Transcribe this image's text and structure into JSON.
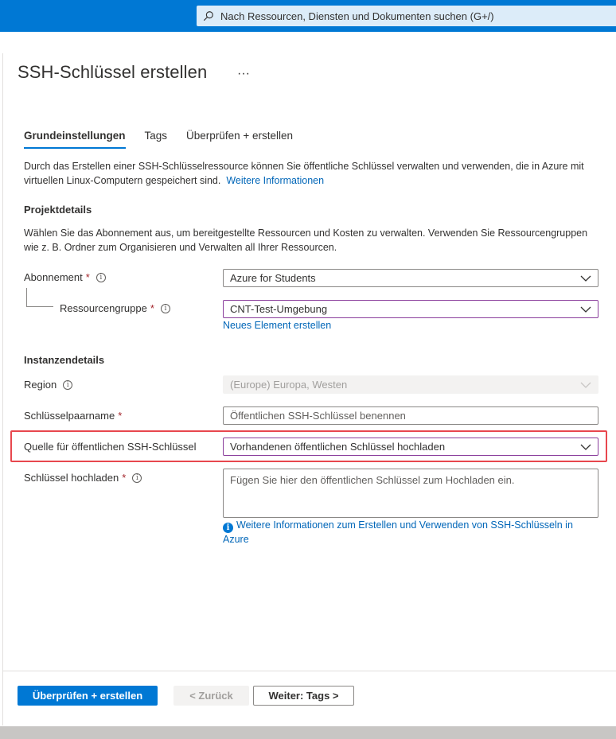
{
  "search": {
    "placeholder": "Nach Ressourcen, Diensten und Dokumenten suchen (G+/)"
  },
  "header": {
    "title": "SSH-Schlüssel erstellen",
    "more": "···"
  },
  "tabs": [
    {
      "label": "Grundeinstellungen",
      "active": true
    },
    {
      "label": "Tags",
      "active": false
    },
    {
      "label": "Überprüfen + erstellen",
      "active": false
    }
  ],
  "intro": {
    "text": "Durch das Erstellen einer SSH-Schlüsselressource können Sie öffentliche Schlüssel verwalten und verwenden, die in Azure mit virtuellen Linux-Computern gespeichert sind.",
    "link": "Weitere Informationen"
  },
  "project": {
    "heading": "Projektdetails",
    "description": "Wählen Sie das Abonnement aus, um bereitgestellte Ressourcen und Kosten zu verwalten. Verwenden Sie Ressourcengruppen wie z. B. Ordner zum Organisieren und Verwalten all Ihrer Ressourcen.",
    "subscription_label": "Abonnement",
    "subscription_value": "Azure for Students",
    "resource_group_label": "Ressourcengruppe",
    "resource_group_value": "CNT-Test-Umgebung",
    "new_element_link": "Neues Element erstellen"
  },
  "instance": {
    "heading": "Instanzendetails",
    "region_label": "Region",
    "region_value": "(Europe) Europa, Westen",
    "keypair_label": "Schlüsselpaarname",
    "keypair_placeholder": "Öffentlichen SSH-Schlüssel benennen",
    "source_label": "Quelle für öffentlichen SSH-Schlüssel",
    "source_value": "Vorhandenen öffentlichen Schlüssel hochladen",
    "upload_label": "Schlüssel hochladen",
    "upload_placeholder": "Fügen Sie hier den öffentlichen Schlüssel zum Hochladen ein.",
    "info_link": "Weitere Informationen zum Erstellen und Verwenden von SSH-Schlüsseln in Azure"
  },
  "footer": {
    "review_button": "Überprüfen + erstellen",
    "back_button": "< Zurück",
    "next_button": "Weiter: Tags >"
  },
  "colors": {
    "accent": "#0078d4",
    "highlight": "#e8474e",
    "required": "#a4262c"
  }
}
